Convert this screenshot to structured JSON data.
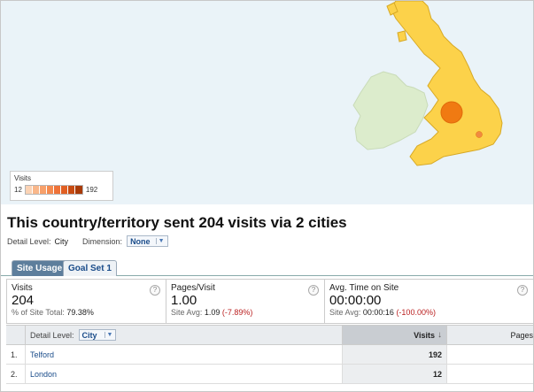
{
  "legend": {
    "title": "Visits",
    "min": "12",
    "max": "192",
    "colors": [
      "#fbd3b5",
      "#f9b78a",
      "#f7a06b",
      "#f48a4f",
      "#ee7238",
      "#e15f22",
      "#c74b12",
      "#a83a08"
    ]
  },
  "map": {
    "sea_color": "#eaf3f8",
    "land_color": "#fcd24a",
    "ireland_color": "#dceccc",
    "marker_large_color": "#f07a12",
    "marker_small_color": "#f08a42"
  },
  "heading": "This country/territory sent 204 visits via 2 cities",
  "detail": {
    "level_label": "Detail Level:",
    "level_value": "City",
    "dimension_label": "Dimension:",
    "dimension_value": "None"
  },
  "tabs": [
    {
      "label": "Site Usage"
    },
    {
      "label": "Goal Set 1"
    }
  ],
  "metrics": [
    {
      "label": "Visits",
      "value": "204",
      "sub_prefix": "% of Site Total:",
      "sub_value": "79.38%",
      "sub_change": ""
    },
    {
      "label": "Pages/Visit",
      "value": "1.00",
      "sub_prefix": "Site Avg:",
      "sub_value": "1.09",
      "sub_change": "(-7.89%)"
    },
    {
      "label": "Avg. Time on Site",
      "value": "00:00:00",
      "sub_prefix": "Site Avg:",
      "sub_value": "00:00:16",
      "sub_change": "(-100.00%)"
    }
  ],
  "help_glyph": "?",
  "table": {
    "detail_label": "Detail Level:",
    "detail_value": "City",
    "col_visits": "Visits",
    "col_pages": "Pages",
    "sort_arrow": "↓",
    "rows": [
      {
        "num": "1.",
        "city": "Telford",
        "visits": "192"
      },
      {
        "num": "2.",
        "city": "London",
        "visits": "12"
      }
    ]
  }
}
